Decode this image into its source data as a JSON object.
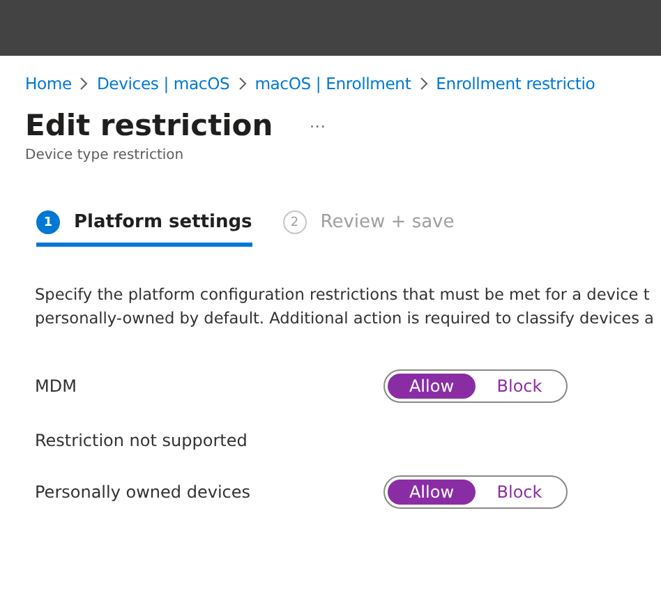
{
  "breadcrumb": [
    "Home",
    "Devices | macOS",
    "macOS | Enrollment",
    "Enrollment restrictio"
  ],
  "title": "Edit restriction",
  "more": "···",
  "subtitle": "Device type restriction",
  "steps": [
    {
      "number": "1",
      "label": "Platform settings",
      "selected": true
    },
    {
      "number": "2",
      "label": "Review + save",
      "selected": false
    }
  ],
  "description": [
    "Specify the platform configuration restrictions that must be met for a device t",
    "personally-owned by default. Additional action is required to classify devices a"
  ],
  "settings": [
    {
      "kind": "toggle",
      "label": "MDM",
      "options": [
        {
          "label": "Allow",
          "selected": true
        },
        {
          "label": "Block",
          "selected": false
        }
      ]
    },
    {
      "kind": "note",
      "label": "Restriction not supported"
    },
    {
      "kind": "toggle",
      "label": "Personally owned devices",
      "options": [
        {
          "label": "Allow",
          "selected": true
        },
        {
          "label": "Block",
          "selected": false
        }
      ]
    }
  ]
}
